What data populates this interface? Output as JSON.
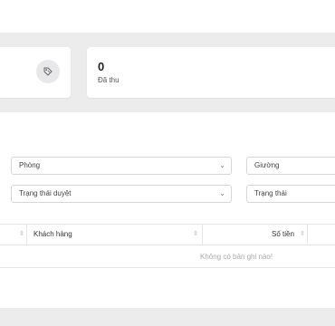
{
  "stats": {
    "collected_value": "0",
    "collected_label": "Đã thu"
  },
  "filters": {
    "room": "Phòng",
    "bed": "Giường",
    "approval_status": "Trạng thái duyệt",
    "status": "Trạng thái",
    "chevron": "⌄"
  },
  "table": {
    "sort_glyph": "⇳",
    "headers": {
      "customer": "Khách hàng",
      "amount": "Số tiền"
    },
    "empty_message": "Không có bản ghi nào!"
  }
}
